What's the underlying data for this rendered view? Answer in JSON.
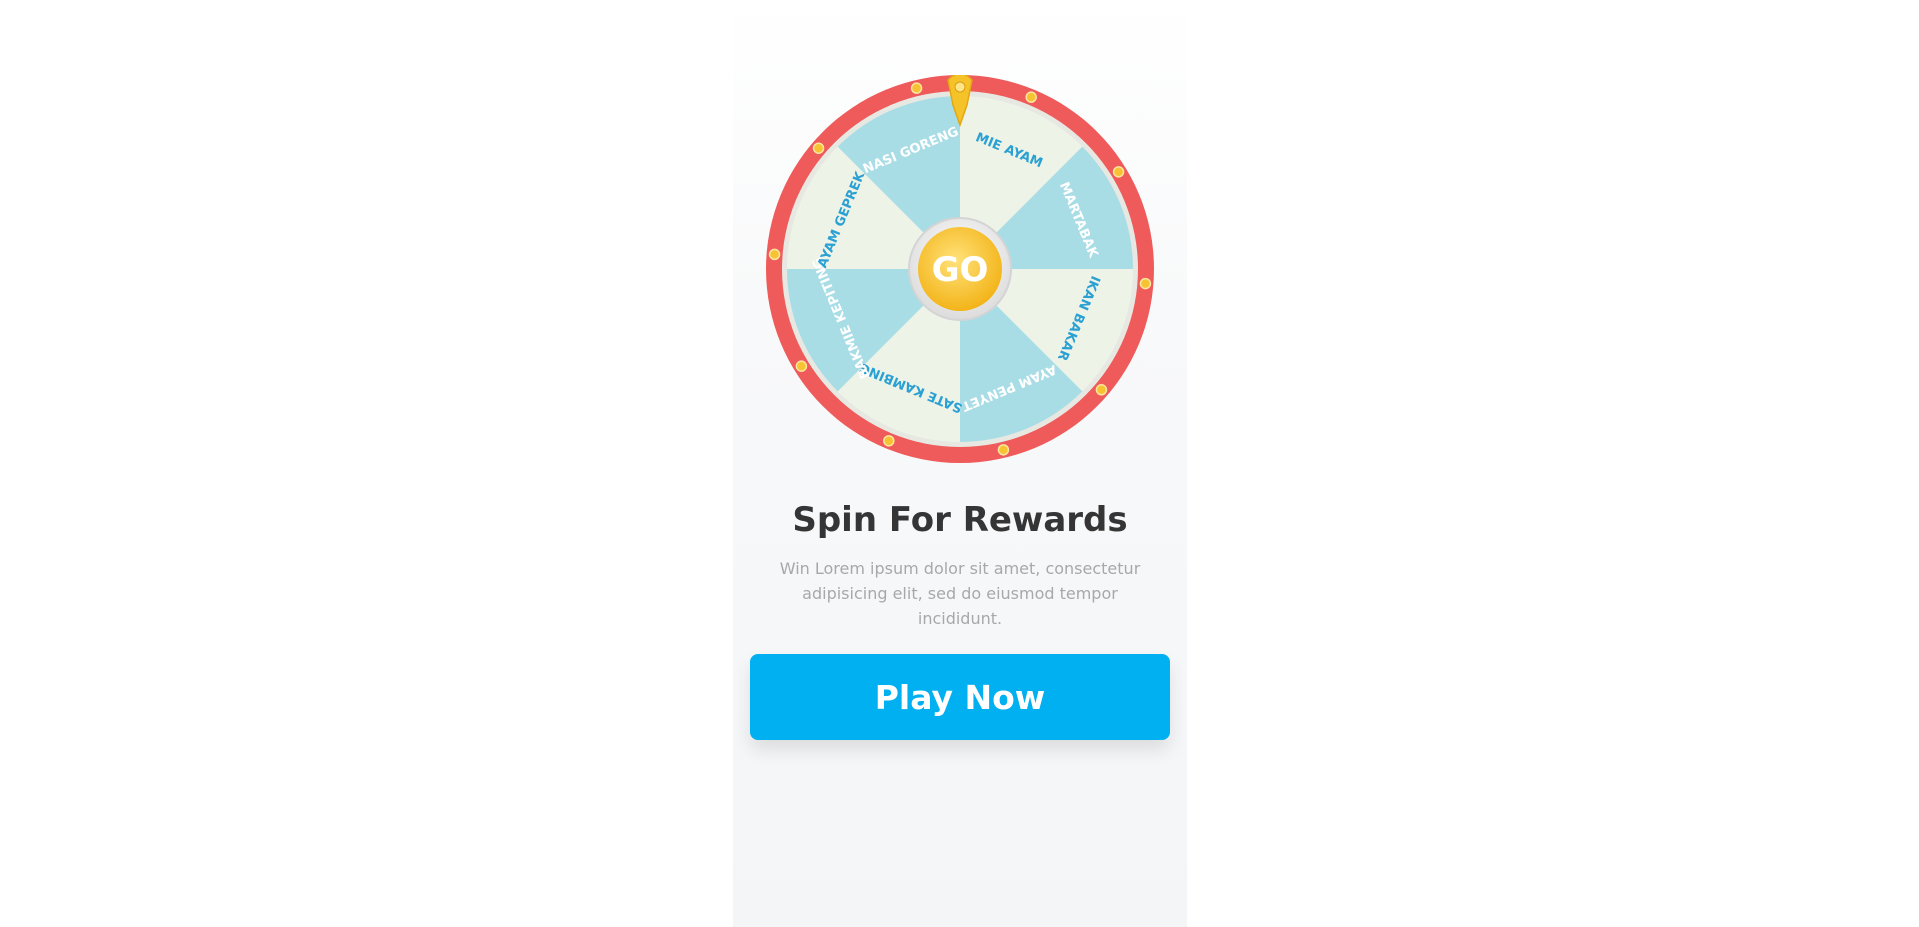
{
  "wheel": {
    "center_label": "GO",
    "segments": [
      {
        "label": "MIE AYAM",
        "fill": "#eef3e8",
        "text_color": "#2aa0d3"
      },
      {
        "label": "MARTABAK",
        "fill": "#a9dde6",
        "text_color": "#ffffff"
      },
      {
        "label": "IKAN BAKAR",
        "fill": "#eef3e8",
        "text_color": "#2aa0d3"
      },
      {
        "label": "AYAM PENYET",
        "fill": "#a9dde6",
        "text_color": "#ffffff"
      },
      {
        "label": "SATE KAMBING",
        "fill": "#eef3e8",
        "text_color": "#2aa0d3"
      },
      {
        "label": "BAKMIE KEPITING",
        "fill": "#a9dde6",
        "text_color": "#ffffff"
      },
      {
        "label": "AYAM GEPREK",
        "fill": "#eef3e8",
        "text_color": "#2aa0d3"
      },
      {
        "label": "NASI GORENG",
        "fill": "#a9dde6",
        "text_color": "#ffffff"
      }
    ],
    "colors": {
      "rim": "#ef5a5a",
      "bulb": "#f7c332",
      "hub": "#f5b820",
      "pointer": "#f5c22a"
    }
  },
  "content": {
    "title": "Spin For Rewards",
    "description": "Win Lorem ipsum dolor sit amet, consectetur adipisicing elit, sed do eiusmod tempor incididunt."
  },
  "cta": {
    "label": "Play Now",
    "color": "#00b0f0"
  }
}
